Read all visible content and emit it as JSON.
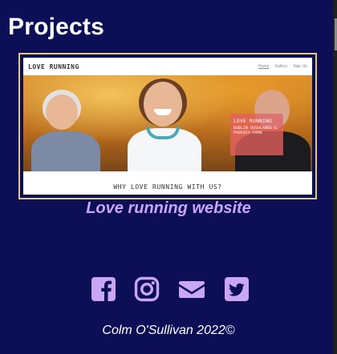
{
  "page": {
    "title": "Projects"
  },
  "project": {
    "site_logo": "LOVE RUNNING",
    "site_nav": [
      "Home",
      "Gallery",
      "Sign Up"
    ],
    "promo_title": "LOVE RUNNING",
    "promo_subtitle": "DUBLIN BUSHLANDS & PHOENIX PARK",
    "why_heading": "WHY LOVE RUNNING WITH US?",
    "caption": "Love running website"
  },
  "social": {
    "icons": [
      "facebook-icon",
      "instagram-icon",
      "envelope-icon",
      "twitter-icon"
    ],
    "color": "#c9a6f6"
  },
  "footer": {
    "text": "Colm O'Sullivan 2022©"
  },
  "colors": {
    "background": "#0d0f56",
    "card_border": "#e5c87b",
    "accent": "#c9a6f6"
  }
}
